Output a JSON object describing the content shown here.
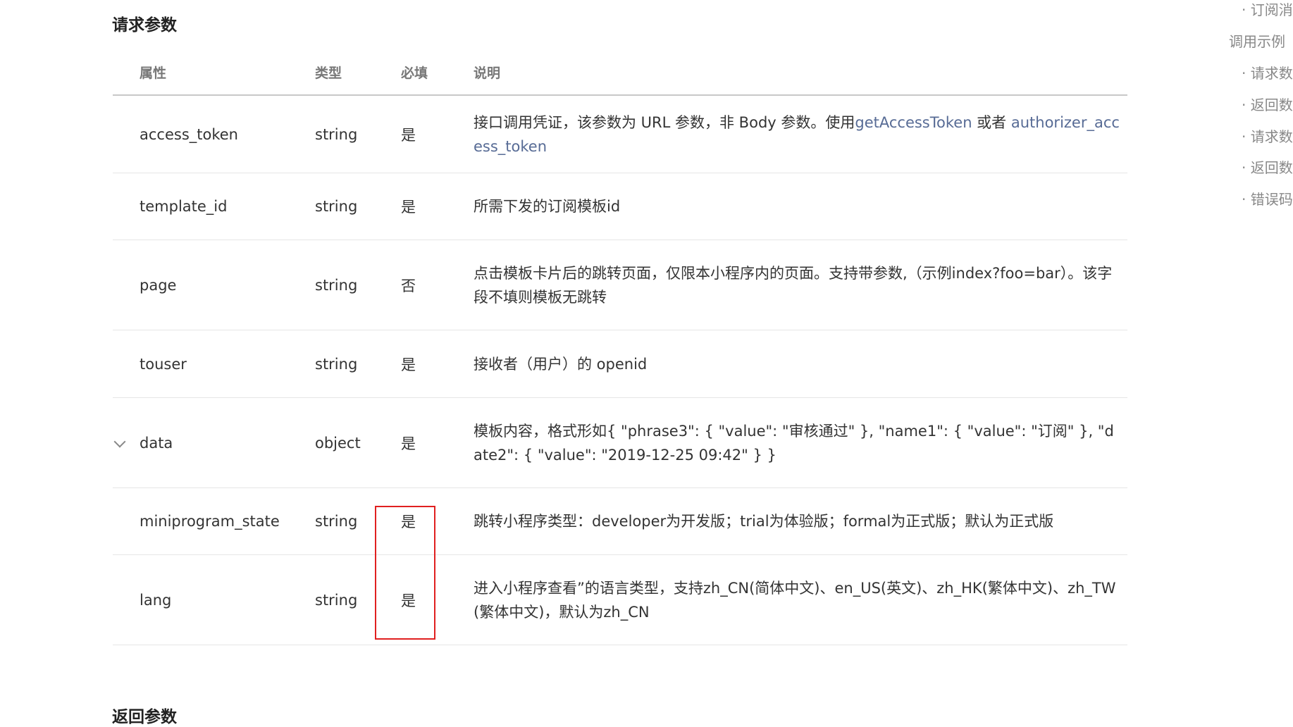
{
  "sections": {
    "request_title": "请求参数",
    "response_title": "返回参数"
  },
  "table": {
    "headers": {
      "name": "属性",
      "type": "类型",
      "required": "必填",
      "description": "说明"
    },
    "rows": [
      {
        "name": "access_token",
        "type": "string",
        "required": "是",
        "desc_parts": [
          {
            "text": "接口调用凭证，该参数为 URL 参数，非 Body 参数。使用",
            "link": false
          },
          {
            "text": "getAccessToken",
            "link": true
          },
          {
            "text": " 或者 ",
            "link": false
          },
          {
            "text": "authorizer_access_token",
            "link": true
          }
        ]
      },
      {
        "name": "template_id",
        "type": "string",
        "required": "是",
        "desc_parts": [
          {
            "text": "所需下发的订阅模板id",
            "link": false
          }
        ]
      },
      {
        "name": "page",
        "type": "string",
        "required": "否",
        "desc_parts": [
          {
            "text": "点击模板卡片后的跳转页面，仅限本小程序内的页面。支持带参数,（示例index?foo=bar）。该字段不填则模板无跳转",
            "link": false
          }
        ]
      },
      {
        "name": "touser",
        "type": "string",
        "required": "是",
        "desc_parts": [
          {
            "text": "接收者（用户）的 openid",
            "link": false
          }
        ]
      },
      {
        "name": "data",
        "type": "object",
        "required": "是",
        "expandable": true,
        "desc_parts": [
          {
            "text": "模板内容，格式形如{ \"phrase3\": { \"value\": \"审核通过\" }, \"name1\": { \"value\": \"订阅\" }, \"date2\": { \"value\": \"2019-12-25 09:42\" } }",
            "link": false
          }
        ]
      },
      {
        "name": "miniprogram_state",
        "type": "string",
        "required": "是",
        "desc_parts": [
          {
            "text": "跳转小程序类型：developer为开发版；trial为体验版；formal为正式版；默认为正式版",
            "link": false
          }
        ]
      },
      {
        "name": "lang",
        "type": "string",
        "required": "是",
        "desc_parts": [
          {
            "text": "进入小程序查看”的语言类型，支持zh_CN(简体中文)、en_US(英文)、zh_HK(繁体中文)、zh_TW(繁体中文)，默认为zh_CN",
            "link": false
          }
        ]
      }
    ]
  },
  "toc": {
    "items": [
      {
        "label": "· 订阅消",
        "level": "sub"
      },
      {
        "label": "调用示例",
        "level": "top"
      },
      {
        "label": "· 请求数",
        "level": "sub"
      },
      {
        "label": "· 返回数",
        "level": "sub"
      },
      {
        "label": "· 请求数",
        "level": "sub"
      },
      {
        "label": "· 返回数",
        "level": "sub"
      },
      {
        "label": "· 错误码",
        "level": "sub"
      }
    ]
  },
  "colors": {
    "link": "#576b95",
    "highlight": "#e02020",
    "header_text": "#777777"
  },
  "icons": {
    "expand": "chevron-down-icon"
  }
}
